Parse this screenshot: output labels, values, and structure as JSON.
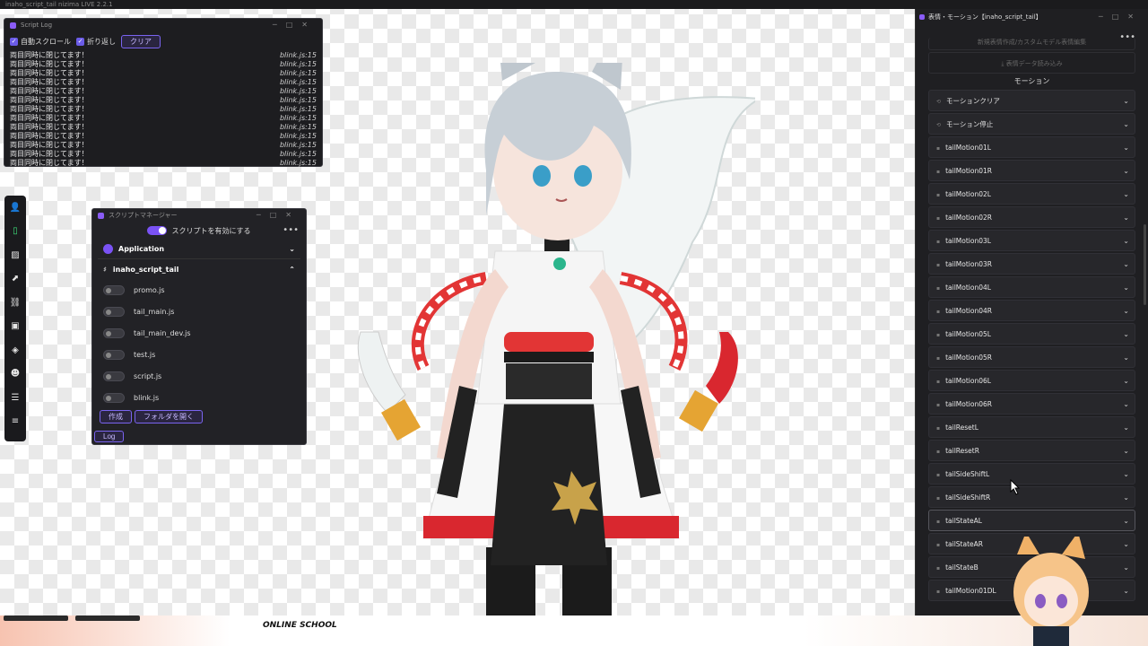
{
  "app": {
    "title": "inaho_script_tail nizima LIVE 2.2.1"
  },
  "script_log": {
    "title": "Script Log",
    "auto_scroll": "自動スクロール",
    "wrap": "折り返し",
    "clear": "クリア",
    "lines": [
      {
        "msg": "両目同時に閉じてます！",
        "src": "blink.js:15"
      },
      {
        "msg": "両目同時に閉じてます！",
        "src": "blink.js:15"
      },
      {
        "msg": "両目同時に閉じてます！",
        "src": "blink.js:15"
      },
      {
        "msg": "両目同時に閉じてます！",
        "src": "blink.js:15"
      },
      {
        "msg": "両目同時に閉じてます！",
        "src": "blink.js:15"
      },
      {
        "msg": "両目同時に閉じてます！",
        "src": "blink.js:15"
      },
      {
        "msg": "両目同時に閉じてます！",
        "src": "blink.js:15"
      },
      {
        "msg": "両目同時に閉じてます！",
        "src": "blink.js:15"
      },
      {
        "msg": "両目同時に閉じてます！",
        "src": "blink.js:15"
      },
      {
        "msg": "両目同時に閉じてます！",
        "src": "blink.js:15"
      },
      {
        "msg": "両目同時に閉じてます！",
        "src": "blink.js:15"
      },
      {
        "msg": "両目同時に閉じてます！",
        "src": "blink.js:15"
      },
      {
        "msg": "両目同時に閉じてます！",
        "src": "blink.js:15"
      }
    ]
  },
  "script_manager": {
    "title": "スクリプトマネージャー",
    "enable_label": "スクリプトを有効にする",
    "group_application": "Application",
    "group_tail": "inaho_script_tail",
    "scripts": [
      "promo.js",
      "tail_main.js",
      "tail_main_dev.js",
      "test.js",
      "script.js",
      "blink.js"
    ],
    "create": "作成",
    "open_folder": "フォルダを開く",
    "log": "Log"
  },
  "motion_panel": {
    "title": "表情・モーション【inaho_script_tail】",
    "faded_top": "新規表情作成/カスタムモデル表情編集",
    "load_expression": "表情データ読み込み",
    "section": "モーション",
    "rows": [
      "モーションクリア",
      "モーション停止",
      "tailMotion01L",
      "tailMotion01R",
      "tailMotion02L",
      "tailMotion02R",
      "tailMotion03L",
      "tailMotion03R",
      "tailMotion04L",
      "tailMotion04R",
      "tailMotion05L",
      "tailMotion05R",
      "tailMotion06L",
      "tailMotion06R",
      "tailResetL",
      "tailResetR",
      "tailSideShiftL",
      "tailSideShiftR",
      "tailStateAL",
      "tailStateAR",
      "tailStateB",
      "tailMotion01DL"
    ]
  },
  "bottom": {
    "school": "ONLINE SCHOOL"
  },
  "colors": {
    "accent": "#7a52f5",
    "active_tool": "#3ee07a"
  }
}
